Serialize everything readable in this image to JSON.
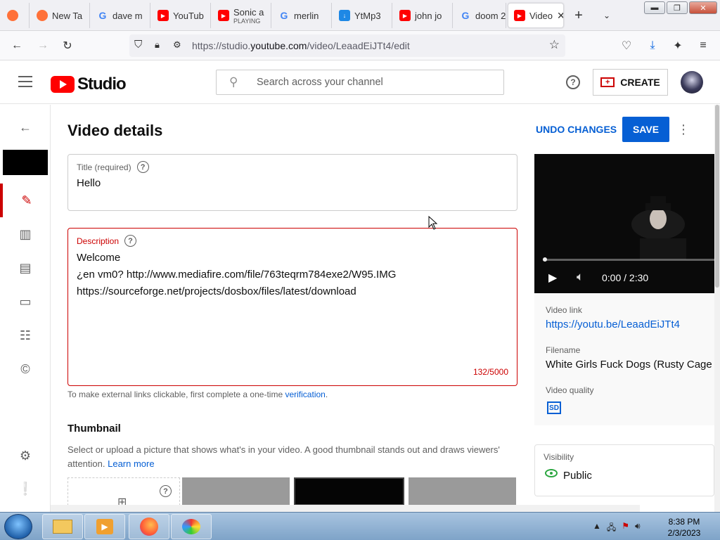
{
  "browser": {
    "tabs": [
      {
        "label": "",
        "icon": "firefox-icon",
        "color": "#ff7139"
      },
      {
        "label": "New Ta",
        "icon": "firefox-icon",
        "color": "#ff7139"
      },
      {
        "label": "dave m",
        "icon": "google-icon",
        "color": "#4285f4"
      },
      {
        "label": "YouTub",
        "icon": "youtube-icon",
        "color": "#ff0000"
      },
      {
        "label": "Sonic a",
        "sub": "PLAYING",
        "icon": "youtube-icon",
        "color": "#ff0000"
      },
      {
        "label": "merlin",
        "icon": "google-icon",
        "color": "#4285f4"
      },
      {
        "label": "YtMp3",
        "icon": "ytmp3-icon",
        "color": "#1e88e5"
      },
      {
        "label": "john jo",
        "icon": "youtube-icon",
        "color": "#ff0000"
      },
      {
        "label": "doom 2",
        "icon": "google-icon",
        "color": "#4285f4"
      },
      {
        "label": "Video",
        "icon": "youtube-icon",
        "color": "#ff0000"
      }
    ],
    "url_prefix": "https://studio.",
    "url_domain": "youtube.com",
    "url_path": "/video/LeaadEiJTt4/edit"
  },
  "studio": {
    "logo_text": "Studio",
    "search_placeholder": "Search across your channel",
    "create_label": "CREATE"
  },
  "page": {
    "title": "Video details",
    "undo_label": "UNDO CHANGES",
    "save_label": "SAVE"
  },
  "form": {
    "title_label": "Title (required)",
    "title_value": "Hello",
    "description_label": "Description",
    "description_lines": [
      "Welcome",
      "¿en vm0? http://www.mediafire.com/file/763teqrm784exe2/W95.IMG",
      "https://sourceforge.net/projects/dosbox/files/latest/download"
    ],
    "char_count": "132/5000",
    "hint_text": "To make external links clickable, first complete a one-time ",
    "hint_link": "verification",
    "hint_end": "."
  },
  "thumbnail": {
    "title": "Thumbnail",
    "desc": "Select or upload a picture that shows what's in your video. A good thumbnail stands out and draws viewers' attention. ",
    "learn_more": "Learn more"
  },
  "video": {
    "time": "0:00 / 2:30",
    "link_label": "Video link",
    "link_value": "https://youtu.be/LeaadEiJTt4",
    "filename_label": "Filename",
    "filename_value": "White Girls Fuck Dogs (Rusty Cage R",
    "quality_label": "Video quality",
    "quality_badge": "SD"
  },
  "visibility": {
    "label": "Visibility",
    "value": "Public"
  },
  "taskbar": {
    "time": "8:38 PM",
    "date": "2/3/2023"
  }
}
